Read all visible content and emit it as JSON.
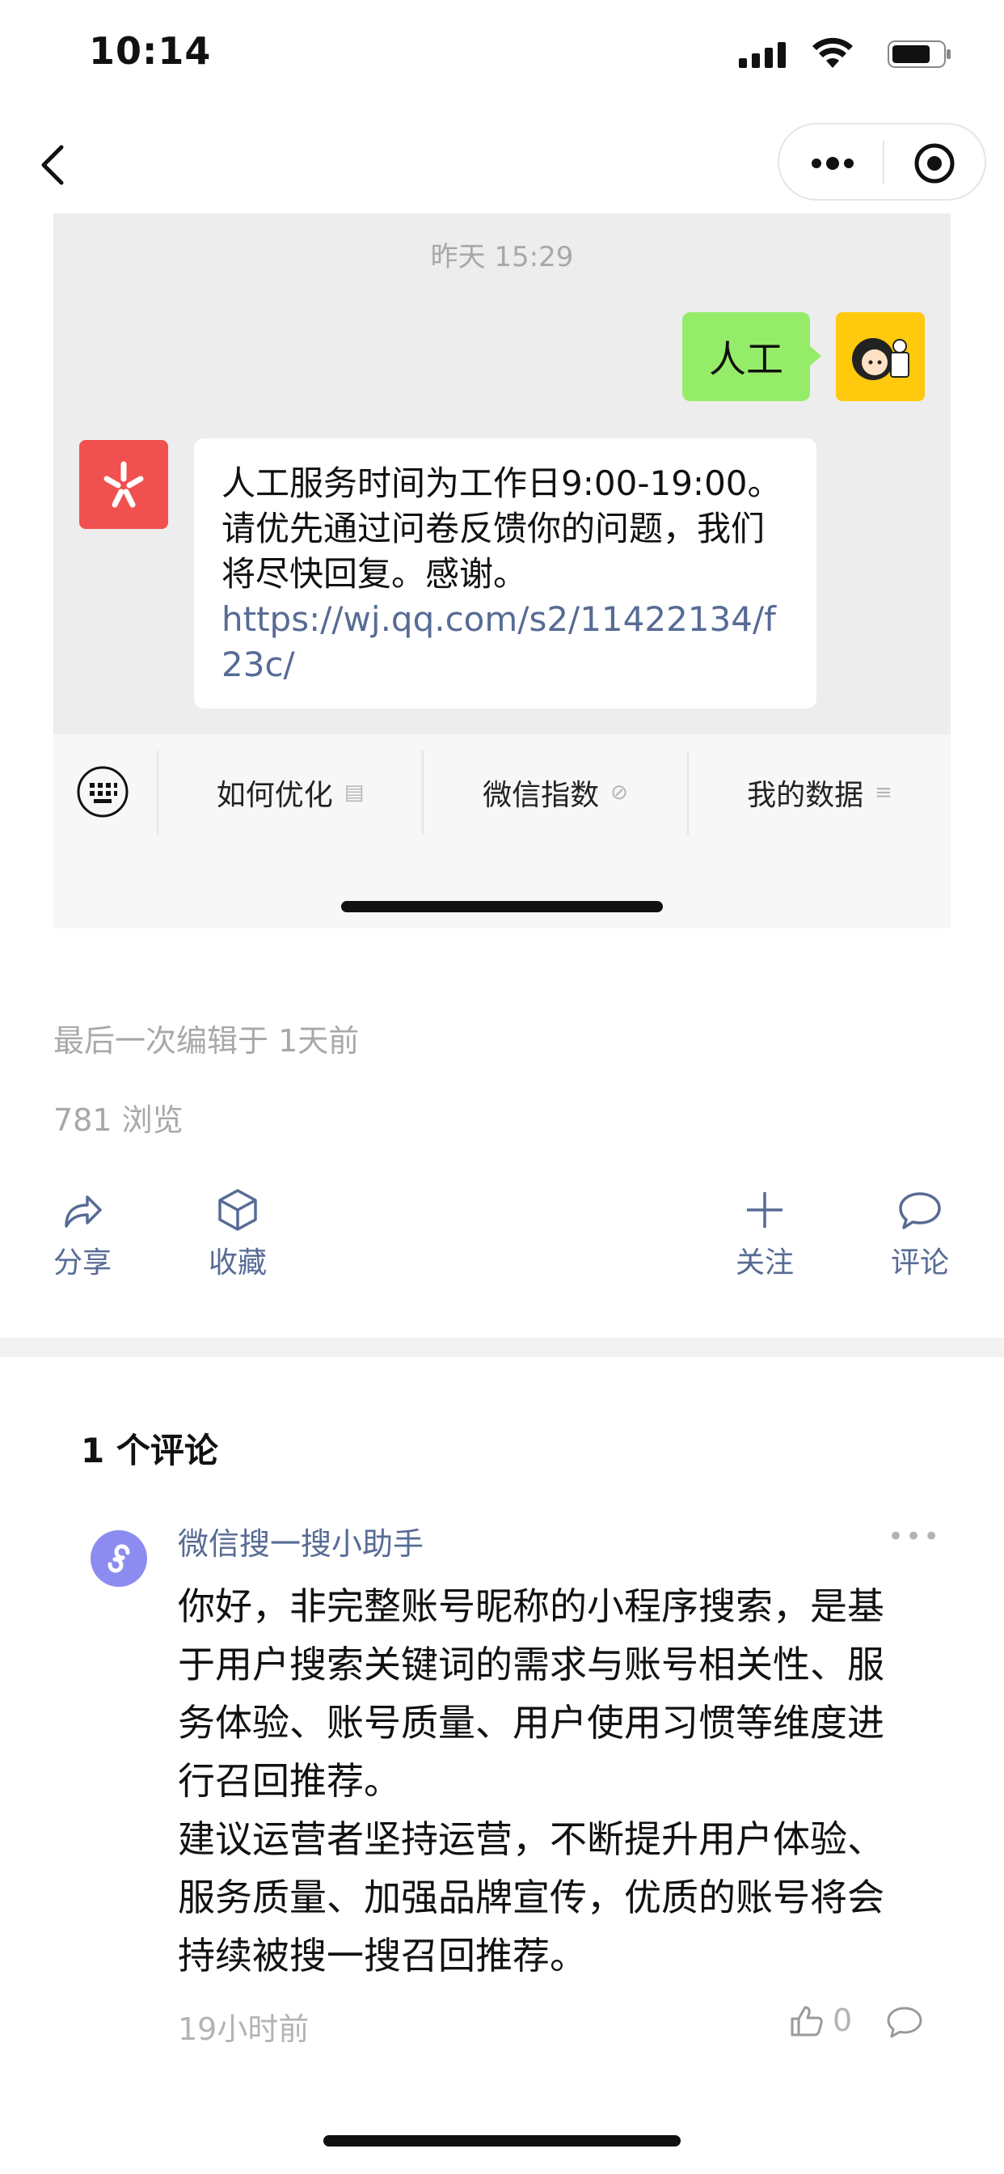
{
  "status_bar": {
    "time": "10:14"
  },
  "chat": {
    "timestamp": "昨天 15:29",
    "user_message": "人工",
    "bot_message": "人工服务时间为工作日9:00-19:00。请优先通过问卷反馈你的问题，我们将尽快回复。感谢。",
    "bot_link": "https://wj.qq.com/s2/11422134/f23c/",
    "quick_menu": [
      {
        "label": "如何优化",
        "icon": "doc-icon"
      },
      {
        "label": "微信指数",
        "icon": "link-icon"
      },
      {
        "label": "我的数据",
        "icon": "list-icon"
      }
    ]
  },
  "meta": {
    "last_edit": "最后一次编辑于 1天前",
    "views": "781 浏览"
  },
  "actions": {
    "share": "分享",
    "favorite": "收藏",
    "follow": "关注",
    "comment": "评论"
  },
  "comments": {
    "title": "1 个评论",
    "items": [
      {
        "author": "微信搜一搜小助手",
        "body": "你好，非完整账号昵称的小程序搜索，是基于用户搜索关键词的需求与账号相关性、服务体验、账号质量、用户使用习惯等维度进行召回推荐。\n建议运营者坚持运营，不断提升用户体验、服务质量、加强品牌宣传，优质的账号将会持续被搜一搜召回推荐。",
        "time": "19小时前",
        "likes": "0"
      }
    ]
  }
}
